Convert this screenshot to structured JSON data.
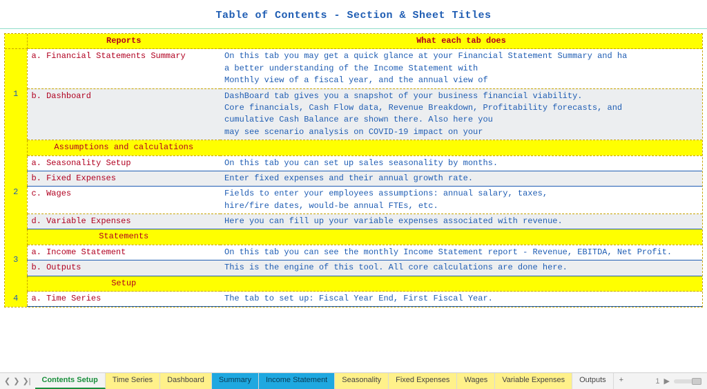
{
  "title": "Table of Contents - Section & Sheet Titles",
  "headers": {
    "col1": "Reports",
    "col2": "What each tab does"
  },
  "groups": [
    {
      "num": "1",
      "section": null,
      "rows": [
        {
          "name": "a. Financial Statements Summary",
          "desc": "On this tab you may get a quick glance at your Financial Statement Summary and ha\na better understanding of the Income Statement with\nMonthly view of a fiscal year, and the annual view of",
          "alt": false,
          "underline": false,
          "sep": true
        },
        {
          "name": "b. Dashboard",
          "desc": "DashBoard tab gives you a snapshot of your business financial viability.\nCore financials, Cash Flow data, Revenue Breakdown, Profitability forecasts, and\ncumulative Cash Balance are shown there. Also here you\nmay see scenario analysis on COVID-19 impact on your",
          "alt": true,
          "underline": false,
          "sep": false
        }
      ]
    },
    {
      "num": "2",
      "section": "Assumptions and calculations",
      "rows": [
        {
          "name": "a. Seasonality Setup",
          "desc": "On this tab you can set up sales seasonality by months.",
          "alt": false,
          "underline": true,
          "sep": false
        },
        {
          "name": "b. Fixed Expenses",
          "desc": "Enter fixed expenses and their annual growth rate.",
          "alt": true,
          "underline": true,
          "sep": false
        },
        {
          "name": "c. Wages",
          "desc": "Fields to enter your employees assumptions: annual salary, taxes,\nhire/fire dates, would-be annual FTEs, etc.",
          "alt": false,
          "underline": false,
          "sep": true
        },
        {
          "name": "d. Variable Expenses",
          "desc": "Here you can fill up your variable expenses associated with revenue.",
          "alt": true,
          "underline": true,
          "sep": false
        }
      ]
    },
    {
      "num": "3",
      "section": "Statements",
      "rows": [
        {
          "name": "a. Income Statement",
          "desc": "On this tab you can see the monthly Income Statement report - Revenue, EBITDA, Net Profit.",
          "alt": false,
          "underline": true,
          "sep": false
        },
        {
          "name": "b. Outputs",
          "desc": "This is the engine of this tool. All core calculations are done here.",
          "alt": true,
          "underline": true,
          "sep": false
        }
      ]
    },
    {
      "num": "4",
      "section": "Setup",
      "rows": [
        {
          "name": "a. Time Series",
          "desc": "The tab to set up: Fiscal Year End, First Fiscal Year.",
          "alt": false,
          "underline": true,
          "sep": false
        }
      ]
    }
  ],
  "tabs": [
    {
      "label": "Contents Setup",
      "style": "active"
    },
    {
      "label": "Time Series",
      "style": "hl-yellow"
    },
    {
      "label": "Dashboard",
      "style": "hl-yellow"
    },
    {
      "label": "Summary",
      "style": "hl-blue"
    },
    {
      "label": "Income Statement",
      "style": "hl-blue"
    },
    {
      "label": "Seasonality",
      "style": "hl-yellow"
    },
    {
      "label": "Fixed Expenses",
      "style": "hl-yellow"
    },
    {
      "label": "Wages",
      "style": "hl-yellow"
    },
    {
      "label": "Variable Expenses",
      "style": "hl-yellow"
    },
    {
      "label": "Outputs",
      "style": ""
    }
  ],
  "nav": {
    "first": "❮",
    "prev": "❯",
    "last": "❯|",
    "add": "+",
    "right_num": "1",
    "right_arrow": "▶"
  }
}
